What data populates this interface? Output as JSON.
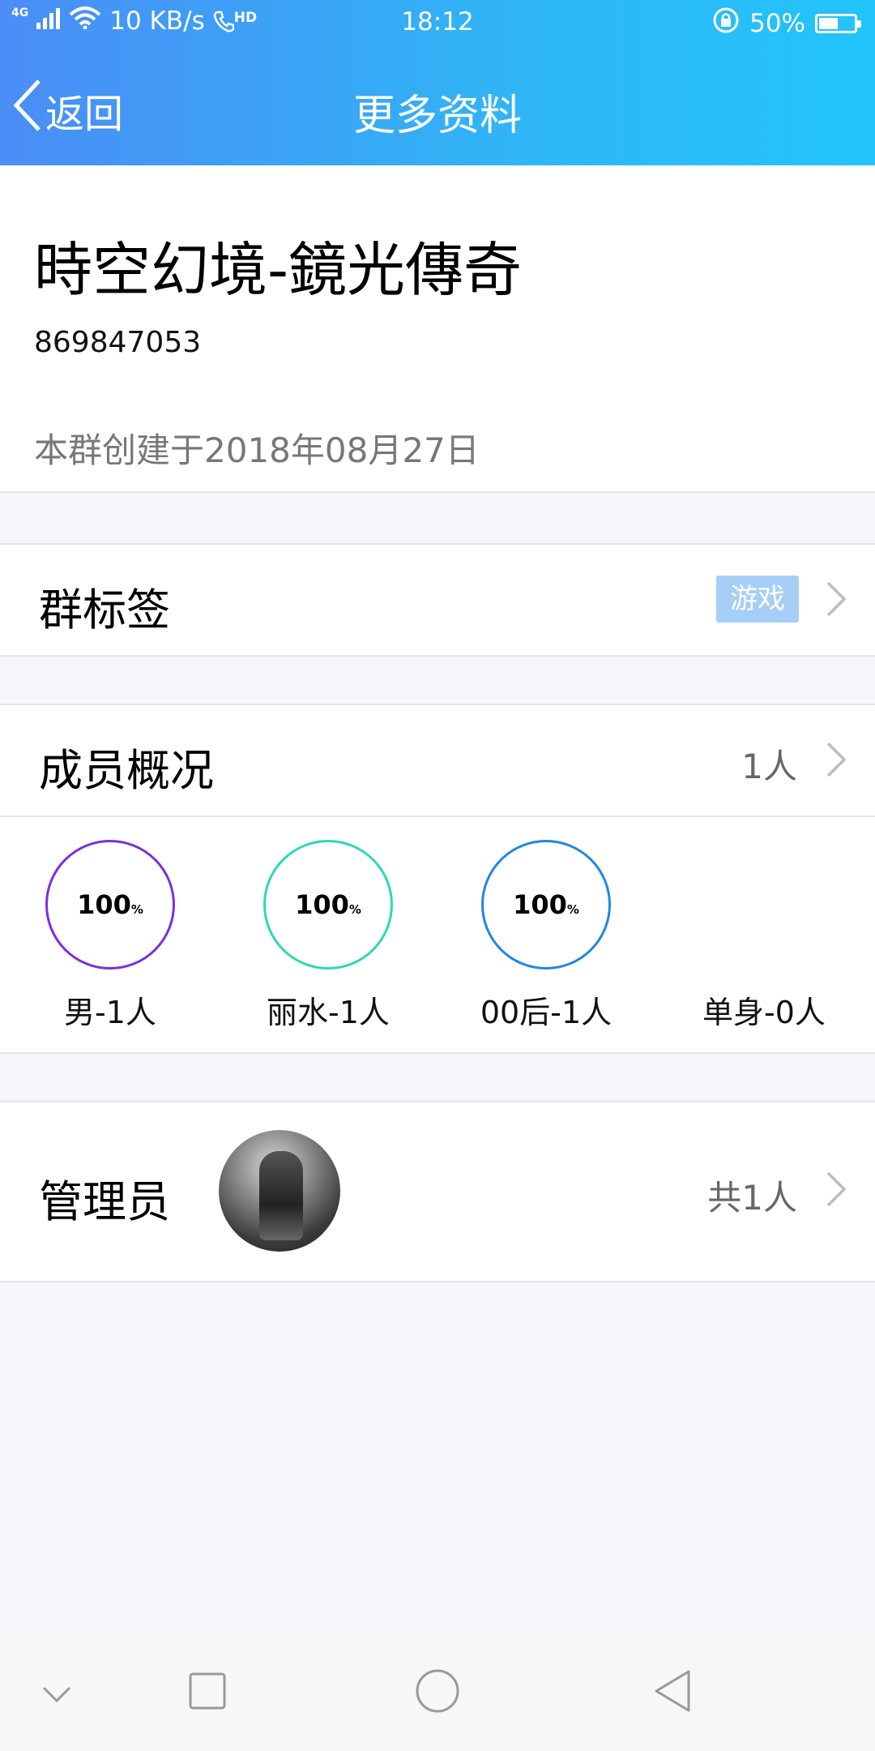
{
  "status_bar": {
    "network_type": "4G",
    "speed": "10 KB/s",
    "call_badge": "HD",
    "time": "18:12",
    "battery": "50%",
    "battery_level": 0.5
  },
  "header": {
    "back_label": "返回",
    "title": "更多资料"
  },
  "group": {
    "name": "時空幻境-鏡光傳奇",
    "id": "869847053",
    "created": "本群创建于2018年08月27日"
  },
  "tags_row": {
    "label": "群标签",
    "tag": "游戏"
  },
  "members_row": {
    "label": "成员概况",
    "count": "1人"
  },
  "stats": [
    {
      "percent": "100",
      "unit": "%",
      "label": "男-1人",
      "color": "#7b2fe0",
      "ring": true
    },
    {
      "percent": "100",
      "unit": "%",
      "label": "丽水-1人",
      "color": "#2ed8b6",
      "ring": true
    },
    {
      "percent": "100",
      "unit": "%",
      "label": "00后-1人",
      "color": "#1f86e6",
      "ring": true
    },
    {
      "percent": "",
      "unit": "",
      "label": "单身-0人",
      "color": "#ffffff",
      "ring": false
    }
  ],
  "admin_row": {
    "label": "管理员",
    "count": "共1人"
  },
  "icons": {
    "back": "chevron-left-icon",
    "row_arrow": "chevron-right-icon",
    "nav": [
      "chevron-down-icon",
      "square-icon",
      "circle-icon",
      "triangle-back-icon"
    ]
  }
}
